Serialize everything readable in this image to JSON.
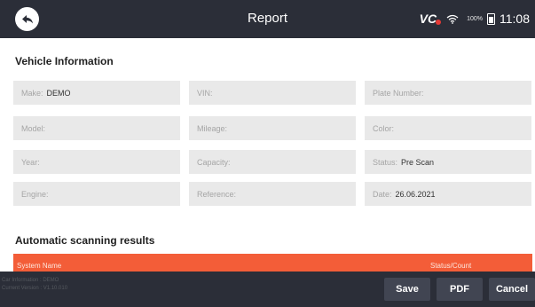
{
  "header": {
    "title": "Report",
    "brand": "VC",
    "battery_percent": "100%",
    "time": "11:08"
  },
  "vehicle_info": {
    "heading": "Vehicle Information",
    "fields": {
      "make": {
        "label": "Make:",
        "value": "DEMO"
      },
      "vin": {
        "label": "VIN:",
        "value": ""
      },
      "plate": {
        "label": "Plate Number:",
        "value": ""
      },
      "model": {
        "label": "Model:",
        "value": ""
      },
      "mileage": {
        "label": "Mileage:",
        "value": ""
      },
      "color": {
        "label": "Color:",
        "value": ""
      },
      "year": {
        "label": "Year:",
        "value": ""
      },
      "capacity": {
        "label": "Capacity:",
        "value": ""
      },
      "status": {
        "label": "Status:",
        "value": "Pre Scan"
      },
      "engine": {
        "label": "Engine:",
        "value": ""
      },
      "reference": {
        "label": "Reference:",
        "value": ""
      },
      "date": {
        "label": "Date:",
        "value": "26.06.2021"
      }
    }
  },
  "scan_results": {
    "heading": "Automatic scanning results",
    "columns": [
      "System Name",
      "Status/Count"
    ]
  },
  "footer": {
    "device_info_line1": "Car Information : DEMO",
    "device_info_line2": "Current Version : V1.10.010",
    "save_label": "Save",
    "pdf_label": "PDF",
    "cancel_label": "Cancel"
  },
  "colors": {
    "bar_bg": "#2b2e38",
    "field_bg": "#e9e9e9",
    "accent": "#f35d38",
    "button_bg": "#414552"
  }
}
